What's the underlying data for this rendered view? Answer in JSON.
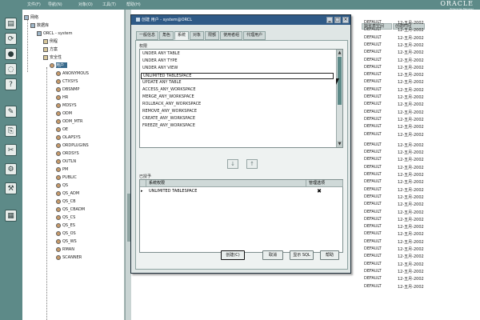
{
  "menubar": {
    "items": [
      "文件(F)",
      "导航(N)",
      "对象(O)",
      "工具(T)",
      "帮助(H)"
    ],
    "brand": "ORACLE",
    "brand_sub": "Enterprise Manager"
  },
  "toolbar": {
    "icons": [
      "console-icon",
      "refresh-icon",
      "connect-icon",
      "disconnect-icon",
      "help-icon",
      "create-icon",
      "edit-icon",
      "delete-icon",
      "show-sql-icon",
      "tools-icon"
    ]
  },
  "tree": {
    "root": "网络",
    "items": [
      {
        "label": "数据库",
        "indent": 1
      },
      {
        "label": "ORCL - system",
        "indent": 2
      },
      {
        "label": "例程",
        "indent": 3
      },
      {
        "label": "方案",
        "indent": 3
      },
      {
        "label": "安全性",
        "indent": 3
      },
      {
        "label": "用户",
        "indent": 4,
        "selected": true
      },
      {
        "label": "ANONYMOUS",
        "indent": 5
      },
      {
        "label": "CTXSYS",
        "indent": 5
      },
      {
        "label": "DBSNMP",
        "indent": 5
      },
      {
        "label": "HR",
        "indent": 5
      },
      {
        "label": "MDSYS",
        "indent": 5
      },
      {
        "label": "ODM",
        "indent": 5
      },
      {
        "label": "ODM_MTR",
        "indent": 5
      },
      {
        "label": "OE",
        "indent": 5
      },
      {
        "label": "OLAPSYS",
        "indent": 5
      },
      {
        "label": "ORDPLUGINS",
        "indent": 5
      },
      {
        "label": "ORDSYS",
        "indent": 5
      },
      {
        "label": "OUTLN",
        "indent": 5
      },
      {
        "label": "PM",
        "indent": 5
      },
      {
        "label": "PUBLIC",
        "indent": 5
      },
      {
        "label": "QS",
        "indent": 5
      },
      {
        "label": "QS_ADM",
        "indent": 5
      },
      {
        "label": "QS_CB",
        "indent": 5
      },
      {
        "label": "QS_CBADM",
        "indent": 5
      },
      {
        "label": "QS_CS",
        "indent": 5
      },
      {
        "label": "QS_ES",
        "indent": 5
      },
      {
        "label": "QS_OS",
        "indent": 5
      },
      {
        "label": "QS_WS",
        "indent": 5
      },
      {
        "label": "RMAN",
        "indent": 5
      },
      {
        "label": "SCANNER",
        "indent": 5
      }
    ]
  },
  "content": {
    "headers": [
      "缺省表空间",
      "创建时间"
    ],
    "rows": [
      [
        "DEFAULT",
        "12-五月-2002"
      ],
      [
        "DEFAULT",
        "12-五月-2002"
      ],
      [
        "DEFAULT",
        "12-五月-2002"
      ],
      [
        "DEFAULT",
        "12-五月-2002"
      ],
      [
        "DEFAULT",
        "12-五月-2002"
      ],
      [
        "DEFAULT",
        "12-五月-2002"
      ],
      [
        "DEFAULT",
        "12-五月-2002"
      ],
      [
        "DEFAULT",
        "12-五月-2002"
      ],
      [
        "DEFAULT",
        "12-五月-2002"
      ],
      [
        "DEFAULT",
        "12-五月-2002"
      ],
      [
        "DEFAULT",
        "12-五月-2002"
      ],
      [
        "DEFAULT",
        "12-五月-2002"
      ],
      [
        "DEFAULT",
        "12-五月-2002"
      ],
      [
        "DEFAULT",
        "12-五月-2002"
      ],
      [
        "DEFAULT",
        "12-五月-2002"
      ],
      [
        "DEFAULT",
        "12-五月-2002"
      ],
      [
        "DEFAULT",
        "12-五月-2002"
      ],
      [
        "DEFAULT",
        "12-五月-2002"
      ],
      [
        "DEFAULT",
        "12-五月-2002"
      ],
      [
        "DEFAULT",
        "12-五月-2002"
      ],
      [
        "DEFAULT",
        "12-五月-2002"
      ],
      [
        "DEFAULT",
        "12-五月-2002"
      ],
      [
        "DEFAULT",
        "12-五月-2002"
      ],
      [
        "DEFAULT",
        "12-五月-2002"
      ],
      [
        "DEFAULT",
        "12-五月-2002"
      ],
      [
        "DEFAULT",
        "12-五月-2002"
      ],
      [
        "DEFAULT",
        "12-五月-2002"
      ],
      [
        "DEFAULT",
        "12-五月-2002"
      ],
      [
        "DEFAULT",
        "12-五月-2002"
      ],
      [
        "DEFAULT",
        "12-五月-2002"
      ],
      [
        "DEFAULT",
        "12-五月-2002"
      ],
      [
        "DEFAULT",
        "12-五月-2002"
      ],
      [
        "DEFAULT",
        "12-五月-2002"
      ],
      [
        "DEFAULT",
        "12-五月-2002"
      ],
      [
        "DEFAULT",
        "12-五月-2002"
      ],
      [
        "DEFAULT",
        "12-五月-2002"
      ]
    ]
  },
  "dialog": {
    "title": "创建 用户 - system@ORCL",
    "tabs": [
      "一般信息",
      "角色",
      "系统",
      "对象",
      "限额",
      "使用者组",
      "代理用户"
    ],
    "active_tab": "系统",
    "list_label": "权限",
    "privileges": [
      "UNDER ANY TABLE",
      "UNDER ANY TYPE",
      "UNDER ANY VIEW",
      "UNLIMITED TABLESPACE",
      "UPDATE ANY TABLE",
      "ACCESS_ANY_WORKSPACE",
      "MERGE_ANY_WORKSPACE",
      "ROLLBACK_ANY_WORKSPACE",
      "REMOVE_ANY_WORKSPACE",
      "CREATE_ANY_WORKSPACE",
      "FREEZE_ANY_WORKSPACE"
    ],
    "focused_index": 3,
    "granted_label": "已授予",
    "grid_headers": [
      "系统权限",
      "管理选项"
    ],
    "granted": [
      {
        "privilege": "UNLIMITED TABLESPACE",
        "admin_option": "✖"
      }
    ],
    "move_down": "↓",
    "move_up": "↑",
    "buttons": [
      "创建(C)",
      "取消",
      "显示 SQL",
      "帮助"
    ]
  }
}
